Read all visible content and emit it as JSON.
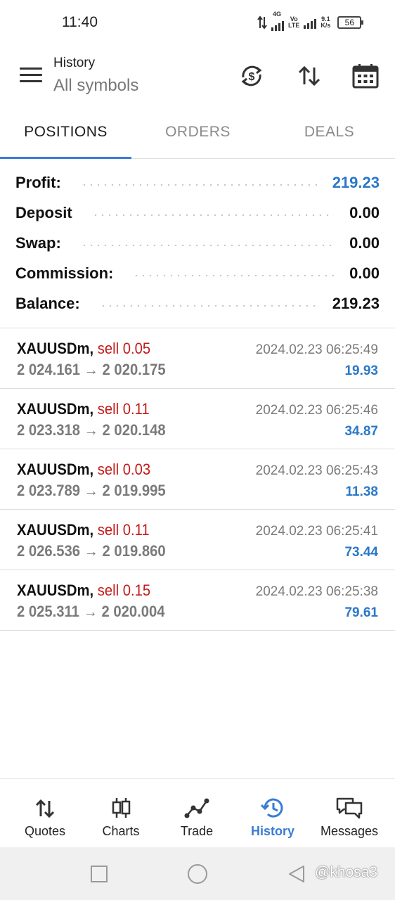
{
  "status_bar": {
    "time": "11:40",
    "net_4g": "4G",
    "volte_top": "Vo",
    "volte_bottom": "LTE",
    "speed_value": "9.1",
    "speed_unit": "K/s",
    "battery": "56"
  },
  "header": {
    "title": "History",
    "subtitle": "All symbols",
    "icons": [
      "currency-sync-icon",
      "sort-icon",
      "calendar-icon"
    ]
  },
  "tabs": [
    {
      "label": "POSITIONS",
      "active": true
    },
    {
      "label": "ORDERS",
      "active": false
    },
    {
      "label": "DEALS",
      "active": false
    }
  ],
  "summary": [
    {
      "label": "Profit:",
      "value": "219.23",
      "highlight": true
    },
    {
      "label": "Deposit",
      "value": "0.00",
      "highlight": false
    },
    {
      "label": "Swap:",
      "value": "0.00",
      "highlight": false
    },
    {
      "label": "Commission:",
      "value": "0.00",
      "highlight": false
    },
    {
      "label": "Balance:",
      "value": "219.23",
      "highlight": false
    }
  ],
  "positions": [
    {
      "symbol": "XAUUSDm,",
      "side": "sell 0.05",
      "open": "2 024.161",
      "arrow": "→",
      "close": "2 020.175",
      "time": "2024.02.23 06:25:49",
      "profit": "19.93"
    },
    {
      "symbol": "XAUUSDm,",
      "side": "sell 0.11",
      "open": "2 023.318",
      "arrow": "→",
      "close": "2 020.148",
      "time": "2024.02.23 06:25:46",
      "profit": "34.87"
    },
    {
      "symbol": "XAUUSDm,",
      "side": "sell 0.03",
      "open": "2 023.789",
      "arrow": "→",
      "close": "2 019.995",
      "time": "2024.02.23 06:25:43",
      "profit": "11.38"
    },
    {
      "symbol": "XAUUSDm,",
      "side": "sell 0.11",
      "open": "2 026.536",
      "arrow": "→",
      "close": "2 019.860",
      "time": "2024.02.23 06:25:41",
      "profit": "73.44"
    },
    {
      "symbol": "XAUUSDm,",
      "side": "sell 0.15",
      "open": "2 025.311",
      "arrow": "→",
      "close": "2 020.004",
      "time": "2024.02.23 06:25:38",
      "profit": "79.61"
    }
  ],
  "bottom_nav": [
    {
      "label": "Quotes",
      "icon": "quotes-icon",
      "active": false
    },
    {
      "label": "Charts",
      "icon": "charts-icon",
      "active": false
    },
    {
      "label": "Trade",
      "icon": "trade-icon",
      "active": false
    },
    {
      "label": "History",
      "icon": "history-icon",
      "active": true
    },
    {
      "label": "Messages",
      "icon": "messages-icon",
      "active": false
    }
  ],
  "watermark": "@khosa3",
  "colors": {
    "accent": "#3a7bd5",
    "profit_blue": "#2a78c9",
    "sell_red": "#c41a1a",
    "muted_gray": "#7a7a7a"
  }
}
